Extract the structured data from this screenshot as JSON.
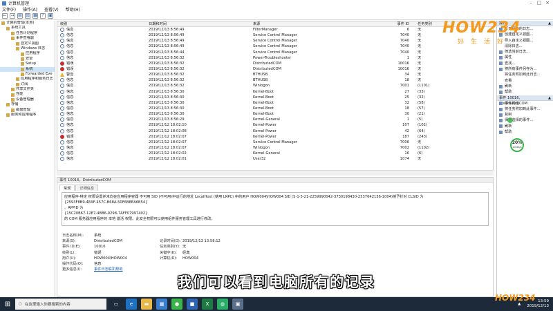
{
  "window": {
    "title": "计算机管理"
  },
  "menu": [
    "文件(F)",
    "操作(A)",
    "查看(V)",
    "帮助(H)"
  ],
  "tree": [
    {
      "label": "计算机管理(本地)",
      "indent": 0
    },
    {
      "label": "系统工具",
      "indent": 1
    },
    {
      "label": "任务计划程序",
      "indent": 2
    },
    {
      "label": "事件查看器",
      "indent": 2
    },
    {
      "label": "自定义视图",
      "indent": 3
    },
    {
      "label": "Windows 日志",
      "indent": 3
    },
    {
      "label": "应用程序",
      "indent": 4
    },
    {
      "label": "安全",
      "indent": 4
    },
    {
      "label": "Setup",
      "indent": 4
    },
    {
      "label": "系统",
      "indent": 4,
      "selected": true
    },
    {
      "label": "Forwarded Eve",
      "indent": 4
    },
    {
      "label": "应用程序和服务日志",
      "indent": 3
    },
    {
      "label": "订阅",
      "indent": 3
    },
    {
      "label": "共享文件夹",
      "indent": 2
    },
    {
      "label": "性能",
      "indent": 2
    },
    {
      "label": "设备管理器",
      "indent": 2
    },
    {
      "label": "存储",
      "indent": 1
    },
    {
      "label": "磁盘管理",
      "indent": 2
    },
    {
      "label": "服务和应用程序",
      "indent": 1
    }
  ],
  "events": {
    "headers": {
      "level": "级别",
      "time": "日期和时间",
      "source": "来源",
      "id": "事件 ID",
      "task": "任务类别"
    },
    "rows": [
      {
        "level": "信息",
        "type": "info",
        "time": "2019/12/13 8:56:49",
        "source": "FilterManager",
        "id": "6",
        "task": "无"
      },
      {
        "level": "信息",
        "type": "info",
        "time": "2019/12/13 8:56:49",
        "source": "Service Control Manager",
        "id": "7040",
        "task": "无"
      },
      {
        "level": "信息",
        "type": "info",
        "time": "2019/12/13 8:56:49",
        "source": "Service Control Manager",
        "id": "7040",
        "task": "无"
      },
      {
        "level": "信息",
        "type": "info",
        "time": "2019/12/13 8:56:49",
        "source": "Service Control Manager",
        "id": "7040",
        "task": "无"
      },
      {
        "level": "信息",
        "type": "info",
        "time": "2019/12/13 8:56:44",
        "source": "Service Control Manager",
        "id": "7040",
        "task": "无"
      },
      {
        "level": "信息",
        "type": "info",
        "time": "2019/12/13 8:56:32",
        "source": "Power-Troubleshooter",
        "id": "1",
        "task": "无"
      },
      {
        "level": "错误",
        "type": "error",
        "time": "2019/12/13 8:56:32",
        "source": "DistributedCOM",
        "id": "10016",
        "task": "无"
      },
      {
        "level": "错误",
        "type": "error",
        "time": "2019/12/13 8:56:32",
        "source": "DistributedCOM",
        "id": "10016",
        "task": "无"
      },
      {
        "level": "警告",
        "type": "warning",
        "time": "2019/12/13 8:56:32",
        "source": "BTHUSB",
        "id": "34",
        "task": "无"
      },
      {
        "level": "信息",
        "type": "info",
        "time": "2019/12/13 8:56:32",
        "source": "BTHUSB",
        "id": "18",
        "task": "无"
      },
      {
        "level": "信息",
        "type": "info",
        "time": "2019/12/13 8:56:32",
        "source": "Winlogon",
        "id": "7001",
        "task": "(1101)"
      },
      {
        "level": "信息",
        "type": "info",
        "time": "2019/12/13 8:56:30",
        "source": "Kernel-Boot",
        "id": "27",
        "task": "(33)"
      },
      {
        "level": "信息",
        "type": "info",
        "time": "2019/12/13 8:56:30",
        "source": "Kernel-Boot",
        "id": "25",
        "task": "(32)"
      },
      {
        "level": "信息",
        "type": "info",
        "time": "2019/12/13 8:56:30",
        "source": "Kernel-Boot",
        "id": "32",
        "task": "(58)"
      },
      {
        "level": "信息",
        "type": "info",
        "time": "2019/12/13 8:56:30",
        "source": "Kernel-Boot",
        "id": "18",
        "task": "(57)"
      },
      {
        "level": "信息",
        "type": "info",
        "time": "2019/12/13 8:56:30",
        "source": "Kernel-Boot",
        "id": "30",
        "task": "(21)"
      },
      {
        "level": "信息",
        "type": "info",
        "time": "2019/12/13 8:56:29",
        "source": "Kernel-General",
        "id": "1",
        "task": "(5)"
      },
      {
        "level": "信息",
        "type": "info",
        "time": "2019/12/12 18:02:10",
        "source": "Kernel-Power",
        "id": "107",
        "task": "(102)"
      },
      {
        "level": "信息",
        "type": "info",
        "time": "2019/12/12 18:02:08",
        "source": "Kernel-Power",
        "id": "42",
        "task": "(64)"
      },
      {
        "level": "错误",
        "type": "error",
        "time": "2019/12/12 18:02:07",
        "source": "Kernel-Power",
        "id": "187",
        "task": "(243)"
      },
      {
        "level": "信息",
        "type": "info",
        "time": "2019/12/12 18:02:07",
        "source": "Service Control Manager",
        "id": "7006",
        "task": "无"
      },
      {
        "level": "信息",
        "type": "info",
        "time": "2019/12/12 18:02:07",
        "source": "Winlogon",
        "id": "7002",
        "task": "(1102)"
      },
      {
        "level": "信息",
        "type": "info",
        "time": "2019/12/12 18:02:02",
        "source": "Kernel-General",
        "id": "16",
        "task": "(6)"
      },
      {
        "level": "信息",
        "type": "info",
        "time": "2019/12/12 18:02:01",
        "source": "User32",
        "id": "1074",
        "task": "无"
      }
    ]
  },
  "details": {
    "title": "事件 10016，DistributedCOM",
    "tabs": [
      "常规",
      "详细信息"
    ],
    "text_lines": [
      "应用程序-特定 权限设置并未向在应用程序容器 不可用 SID (不可用)中运行的地址 LocalHost (使用 LRPC) 中的用户 HOW004\\HOW004 SID (S-1-5-21-2259990042-3730198430-2537642136-1004)授予针对 CLSID 为",
      "{2593F8B9-4EAF-457C-B68A-50F6B8EA6B54}",
      "、APPID 为",
      "{15C20B67-12E7-4BB6-9298-7AFF07997402}",
      "的 COM 服务器应用程序的 本地 激活 权限。此安全权限可以使用组件服务管理工具进行修改。"
    ],
    "fields": [
      {
        "k1": "日志名称(M):",
        "v1": "系统",
        "k2": "",
        "v2": ""
      },
      {
        "k1": "来源(S):",
        "v1": "DistributedCOM",
        "k2": "记录时间(D):",
        "v2": "2019/12/13 13:58:12"
      },
      {
        "k1": "事件 ID(E):",
        "v1": "10016",
        "k2": "任务类别(Y):",
        "v2": "无"
      },
      {
        "k1": "级别(L):",
        "v1": "错误",
        "k2": "关键字(K):",
        "v2": "经典"
      },
      {
        "k1": "用户(U):",
        "v1": "HOW004\\HOW004",
        "k2": "计算机(R):",
        "v2": "HOW004"
      },
      {
        "k1": "操作代码(O):",
        "v1": "信息",
        "k2": "",
        "v2": ""
      },
      {
        "k1": "更多信息(I):",
        "v1": "事件日志联机帮助",
        "k2": "",
        "v2": ""
      }
    ]
  },
  "actions": {
    "section1_head": "操作",
    "items1": [
      {
        "label": "打开保存的日志...",
        "icon": true
      },
      {
        "label": "创建自定义视图...",
        "icon": true
      },
      {
        "label": "导入自定义视图...",
        "icon": false
      },
      {
        "label": "清除日志...",
        "icon": false
      },
      {
        "label": "筛选当前日志...",
        "icon": true
      },
      {
        "label": "属性",
        "icon": true
      },
      {
        "label": "查找...",
        "icon": true
      },
      {
        "label": "将所有事件另存为...",
        "icon": true
      },
      {
        "label": "将任务附加到此日志...",
        "icon": false
      },
      {
        "label": "查看",
        "icon": false
      },
      {
        "label": "刷新",
        "icon": true
      },
      {
        "label": "帮助",
        "icon": true
      }
    ],
    "section2_head": "事件 10016, DistributedCOM",
    "items2": [
      {
        "label": "事件属性",
        "icon": true
      },
      {
        "label": "将任务附加到此事件...",
        "icon": true
      },
      {
        "label": "复制",
        "icon": true
      },
      {
        "label": "保存选择的事件...",
        "icon": true
      },
      {
        "label": "刷新",
        "icon": true
      },
      {
        "label": "帮助",
        "icon": true
      }
    ]
  },
  "caption": "我们可以看到电脑所有的记录",
  "taskbar": {
    "search_placeholder": "在这里输入你要搜索的内容",
    "time": "13:59",
    "date": "2019/12/13"
  },
  "gauge": {
    "percent": "20%",
    "speed": "13.5K/s"
  },
  "logo": {
    "brand": "HOW234",
    "sub": "好生活好",
    "brand_small": "HOW234"
  },
  "colors": {
    "accent_logo": "#f39a1e",
    "selection": "#cce4f7",
    "taskbar": "#1c2a3a",
    "error": "#c8302b",
    "warning": "#e5b417"
  }
}
